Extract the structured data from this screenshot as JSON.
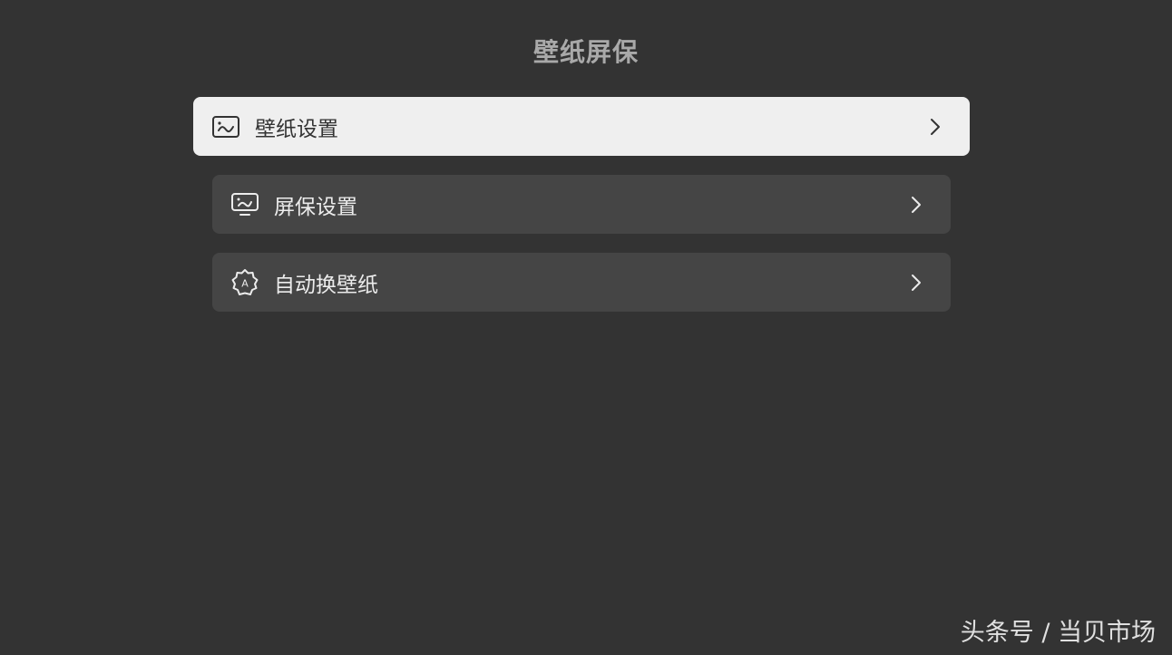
{
  "page": {
    "title": "壁纸屏保"
  },
  "menu": {
    "items": [
      {
        "label": "壁纸设置",
        "icon": "wallpaper-image-icon",
        "focused": true
      },
      {
        "label": "屏保设置",
        "icon": "screensaver-monitor-icon",
        "focused": false
      },
      {
        "label": "自动换壁纸",
        "icon": "auto-change-badge-icon",
        "focused": false
      }
    ]
  },
  "watermark": {
    "text": "头条号 / 当贝市场"
  },
  "colors": {
    "background": "#333333",
    "item_background": "#454545",
    "item_focused_background": "#efefef",
    "title": "#a9a9a9"
  }
}
